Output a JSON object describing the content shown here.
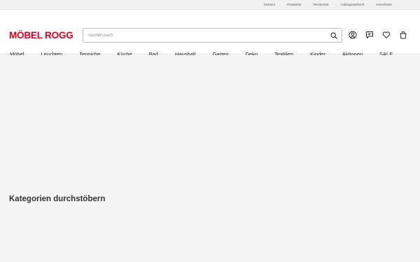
{
  "topbar": {
    "links": [
      "Karriere",
      "Prospekte",
      "Restaurant",
      "Auftragsauskunft",
      "Gutscheine"
    ]
  },
  "header": {
    "logo_text": "MÖBEL ROGG",
    "search": {
      "placeholder": "Suchen nach"
    },
    "icons": [
      "search-icon",
      "account-icon",
      "chat-icon",
      "heart-icon",
      "shopping-bag-icon"
    ]
  },
  "nav": {
    "items": [
      "Möbel",
      "Leuchten",
      "Teppiche",
      "Küche",
      "Bad",
      "Haushalt",
      "Garten",
      "Deko",
      "Textilien",
      "Kinder",
      "Aktionen",
      "SALE"
    ]
  },
  "main": {
    "section_title": "Kategorien durchstöbern"
  },
  "colors": {
    "brand": "#e2001a",
    "background": "#f5f5f5"
  }
}
